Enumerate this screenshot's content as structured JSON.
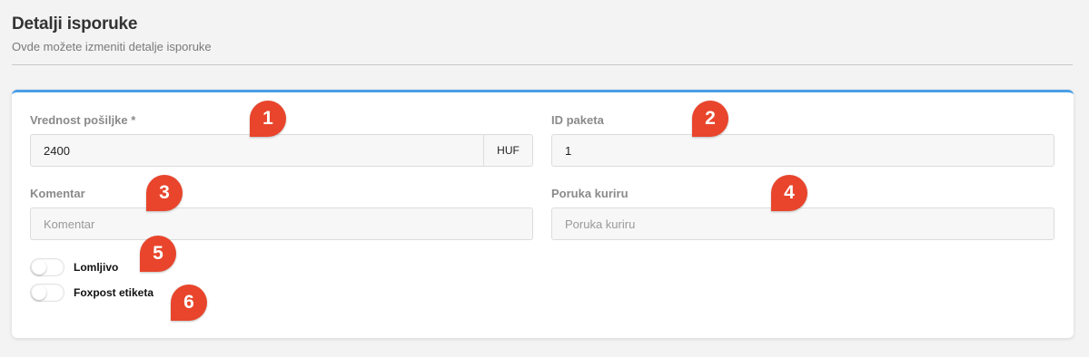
{
  "header": {
    "title": "Detalji isporuke",
    "subtitle": "Ovde možete izmeniti detalje isporuke"
  },
  "form": {
    "value_label": "Vrednost pošiljke *",
    "value": "2400",
    "currency": "HUF",
    "package_id_label": "ID paketa",
    "package_id": "1",
    "comment_label": "Komentar",
    "comment_placeholder": "Komentar",
    "courier_message_label": "Poruka kuriru",
    "courier_message_placeholder": "Poruka kuriru",
    "fragile_label": "Lomljivo",
    "fragile_on": false,
    "foxpost_label": "Foxpost etiketa",
    "foxpost_on": false
  },
  "callouts": [
    "1",
    "2",
    "3",
    "4",
    "5",
    "6"
  ],
  "colors": {
    "accent": "#4a9ee6",
    "callout": "#e8452c"
  }
}
